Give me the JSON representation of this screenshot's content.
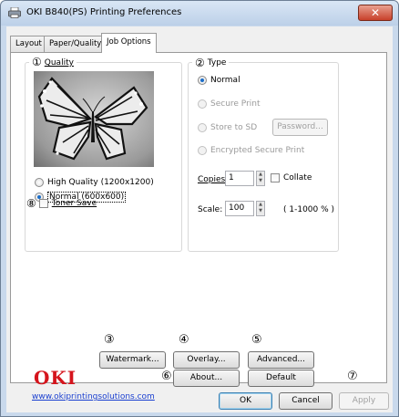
{
  "window": {
    "title": "OKI B840(PS) Printing Preferences",
    "close_label": "✕"
  },
  "tabs": [
    {
      "label": "Layout"
    },
    {
      "label": "Paper/Quality"
    },
    {
      "label": "Job Options"
    }
  ],
  "quality": {
    "marker": "①",
    "label": "Quality",
    "options": [
      {
        "label": "High Quality (1200x1200)",
        "selected": false
      },
      {
        "label": "Normal (600x600)",
        "selected": true
      }
    ],
    "toner_save": {
      "marker": "⑧",
      "label": "Toner Save",
      "checked": false
    }
  },
  "type": {
    "marker": "②",
    "label": "Type",
    "options": [
      {
        "label": "Normal",
        "selected": true,
        "enabled": true
      },
      {
        "label": "Secure Print",
        "selected": false,
        "enabled": false
      },
      {
        "label": "Store to SD",
        "selected": false,
        "enabled": false
      },
      {
        "label": "Encrypted Secure Print",
        "selected": false,
        "enabled": false
      }
    ],
    "password_button": "Password...",
    "copies": {
      "label": "Copies",
      "value": "1"
    },
    "collate": {
      "label": "Collate",
      "checked": false
    },
    "scale": {
      "label": "Scale:",
      "value": "100",
      "range": "( 1-1000 % )"
    }
  },
  "buttons": {
    "watermark": {
      "marker": "③",
      "label": "Watermark..."
    },
    "overlay": {
      "marker": "④",
      "label": "Overlay..."
    },
    "advanced": {
      "marker": "⑤",
      "label": "Advanced..."
    },
    "about": {
      "marker": "⑥",
      "label": "About..."
    },
    "default": {
      "marker": "⑦",
      "label": "Default"
    }
  },
  "brand": {
    "logo_text": "OKI",
    "link": "www.okiprintingsolutions.com",
    "color": "#d5141c"
  },
  "footer": {
    "ok": "OK",
    "cancel": "Cancel",
    "apply": "Apply"
  }
}
